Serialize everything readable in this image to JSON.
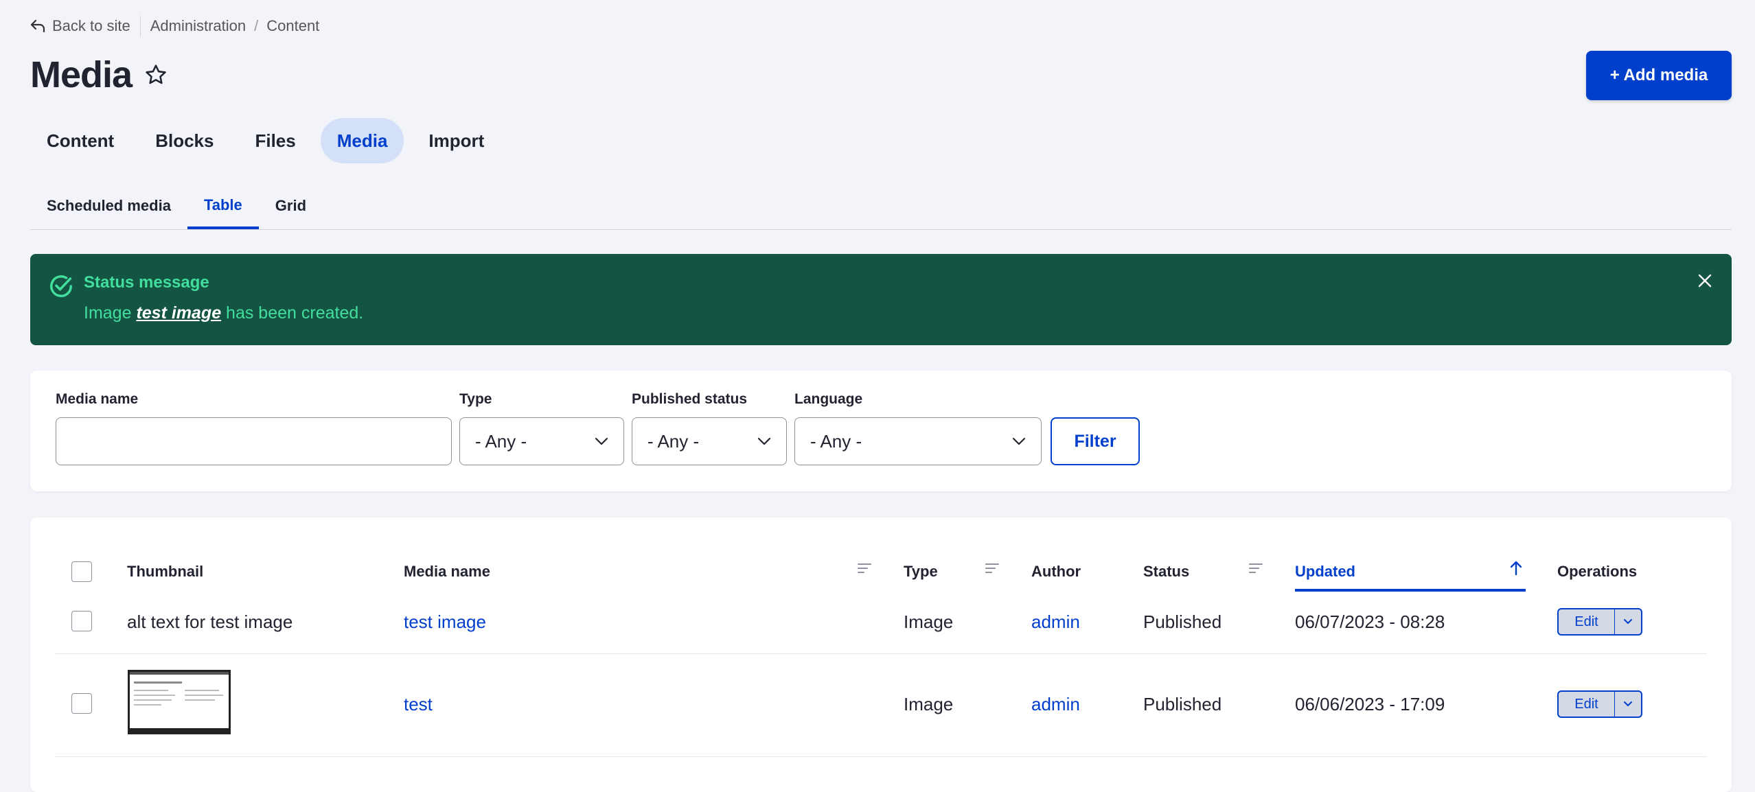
{
  "breadcrumb": {
    "back": "Back to site",
    "items": [
      "Administration",
      "Content"
    ],
    "separator": "/"
  },
  "page": {
    "title": "Media",
    "add_button": "+ Add media"
  },
  "primary_tabs": [
    {
      "label": "Content",
      "active": false
    },
    {
      "label": "Blocks",
      "active": false
    },
    {
      "label": "Files",
      "active": false
    },
    {
      "label": "Media",
      "active": true
    },
    {
      "label": "Import",
      "active": false
    }
  ],
  "secondary_tabs": [
    {
      "label": "Scheduled media",
      "active": false
    },
    {
      "label": "Table",
      "active": true
    },
    {
      "label": "Grid",
      "active": false
    }
  ],
  "status": {
    "heading": "Status message",
    "prefix": "Image ",
    "link": "test image",
    "suffix": " has been created."
  },
  "filters": {
    "media_name_label": "Media name",
    "media_name_value": "",
    "type_label": "Type",
    "type_value": "- Any -",
    "published_label": "Published status",
    "published_value": "- Any -",
    "language_label": "Language",
    "language_value": "- Any -",
    "submit": "Filter"
  },
  "table": {
    "headers": {
      "thumbnail": "Thumbnail",
      "media_name": "Media name",
      "type": "Type",
      "author": "Author",
      "status": "Status",
      "updated": "Updated",
      "operations": "Operations"
    },
    "rows": [
      {
        "thumbnail_text": "alt text for test image",
        "name": "test image",
        "type": "Image",
        "author": "admin",
        "status": "Published",
        "updated": "06/07/2023 - 08:28",
        "edit": "Edit"
      },
      {
        "thumbnail_text": "",
        "name": "test",
        "type": "Image",
        "author": "admin",
        "status": "Published",
        "updated": "06/06/2023 - 17:09",
        "edit": "Edit"
      }
    ]
  },
  "colors": {
    "accent": "#003ecc",
    "status_bg": "#145442",
    "status_text": "#42de9e",
    "page_bg": "#f3f4f9"
  }
}
